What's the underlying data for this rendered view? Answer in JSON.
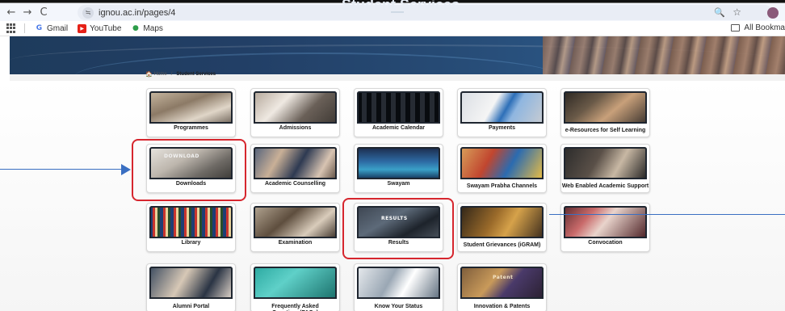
{
  "browser": {
    "url": "ignou.ac.in/pages/4",
    "back_icon": "←",
    "forward_icon": "→",
    "reload_icon": "C",
    "site_info_icon": "≒",
    "zoom_icon": "🔍",
    "star_icon": "☆"
  },
  "bookmarks": {
    "items": [
      {
        "label": "Gmail",
        "icon": "G"
      },
      {
        "label": "YouTube",
        "icon": "▶"
      },
      {
        "label": "Maps",
        "icon": "●"
      }
    ],
    "all_bookmarks_label": "All Bookma"
  },
  "banner": {
    "title": "Student Services"
  },
  "breadcrumb": {
    "home_icon": "🏠",
    "home_label": "Home",
    "separator": "/",
    "current": "Student Services"
  },
  "tiles": [
    {
      "label": "Programmes"
    },
    {
      "label": "Admissions"
    },
    {
      "label": "Academic Calendar"
    },
    {
      "label": "Payments"
    },
    {
      "label": "e-Resources for Self Learning"
    },
    {
      "label": "Downloads",
      "image_text": "DOWNLOAD"
    },
    {
      "label": "Academic Counselling"
    },
    {
      "label": "Swayam"
    },
    {
      "label": "Swayam Prabha Channels"
    },
    {
      "label": "Web Enabled Academic Support"
    },
    {
      "label": "Library"
    },
    {
      "label": "Examination"
    },
    {
      "label": "Results",
      "image_text": "RESULTS"
    },
    {
      "label": "Student Grievances (iGRAM)"
    },
    {
      "label": "Convocation"
    },
    {
      "label": "Alumni Portal"
    },
    {
      "label": "Frequently Asked Questions(FAQs)"
    },
    {
      "label": "Know Your Status"
    },
    {
      "label": "Innovation & Patents",
      "image_text": "Patent"
    }
  ],
  "colors": {
    "highlight": "#d6262e",
    "arrow": "#3a6fc2",
    "banner": "#223f66"
  }
}
